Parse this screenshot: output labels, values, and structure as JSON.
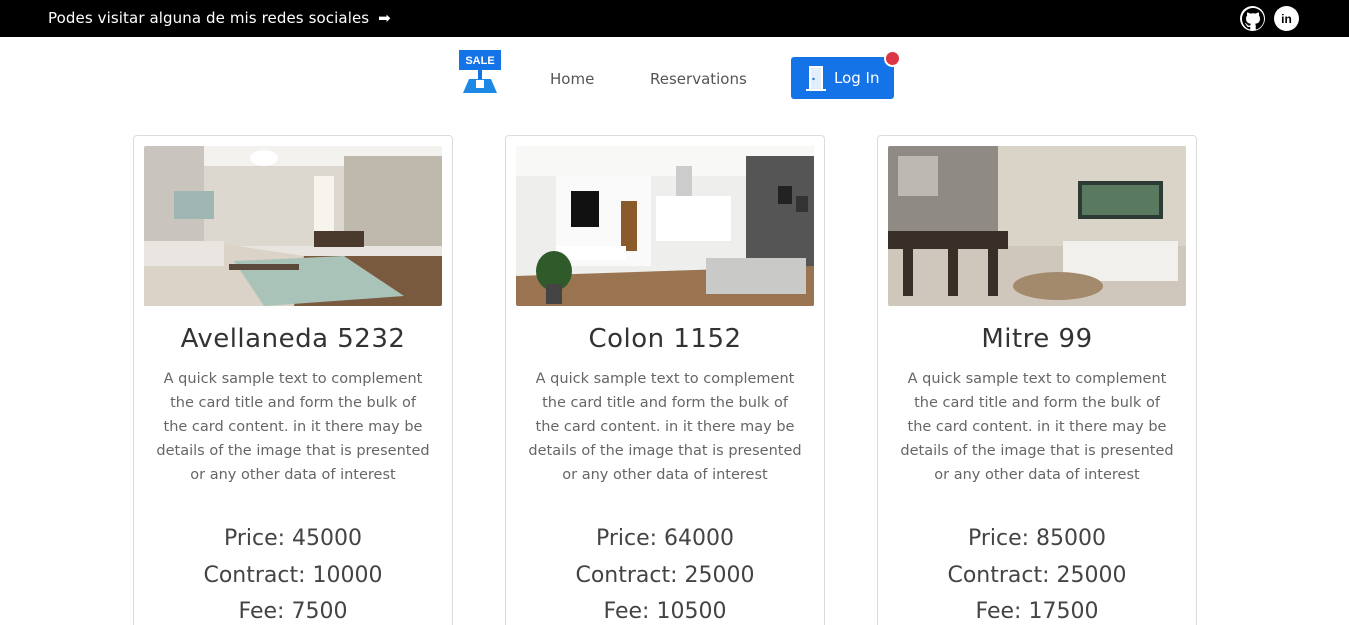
{
  "topbar": {
    "text": "Podes visitar alguna de mis redes sociales",
    "arrow": "➡",
    "github_label": "",
    "linkedin_label": "in"
  },
  "nav": {
    "logo_text": "SALE",
    "home_label": "Home",
    "reservations_label": "Reservations",
    "login_label": "Log In"
  },
  "colors": {
    "accent": "#1473e6",
    "notification": "#dc3545",
    "topbar": "#000000"
  },
  "cards": [
    {
      "title": "Avellaneda 5232",
      "description": "A quick sample text to complement the card title and form the bulk of the card content. in it there may be details of the image that is presented or any other data of interest",
      "price": "Price: 45000",
      "contract": "Contract: 10000",
      "fee": "Fee: 7500"
    },
    {
      "title": "Colon 1152",
      "description": "A quick sample text to complement the card title and form the bulk of the card content. in it there may be details of the image that is presented or any other data of interest",
      "price": "Price: 64000",
      "contract": "Contract: 25000",
      "fee": "Fee: 10500"
    },
    {
      "title": "Mitre 99",
      "description": "A quick sample text to complement the card title and form the bulk of the card content. in it there may be details of the image that is presented or any other data of interest",
      "price": "Price: 85000",
      "contract": "Contract: 25000",
      "fee": "Fee: 17500"
    }
  ]
}
